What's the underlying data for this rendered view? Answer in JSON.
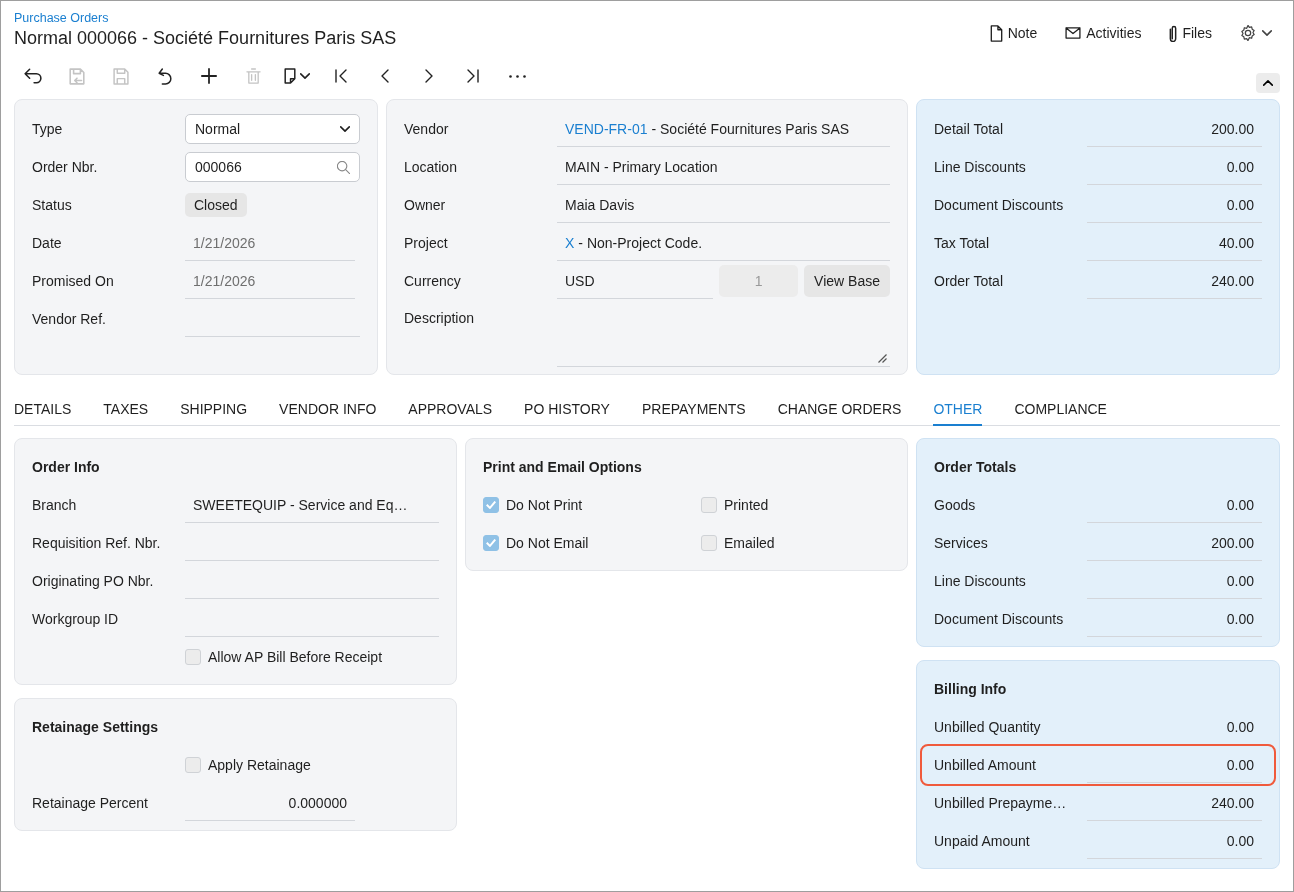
{
  "header": {
    "breadcrumb": "Purchase Orders",
    "title": "Normal 000066 - Société Fournitures Paris SAS",
    "actions": [
      {
        "label": "Note"
      },
      {
        "label": "Activities"
      },
      {
        "label": "Files"
      }
    ]
  },
  "toolbar": [
    {
      "disabled": false
    },
    {
      "disabled": true
    },
    {
      "disabled": true
    },
    {
      "disabled": false
    },
    {
      "disabled": false
    },
    {
      "disabled": true
    },
    {
      "disabled": false
    },
    {
      "disabled": false
    },
    {
      "disabled": false
    },
    {
      "disabled": false
    },
    {
      "disabled": false
    },
    {
      "disabled": false
    }
  ],
  "summary": {
    "fields": [
      {
        "label": "Type",
        "kind": "select",
        "value": "Normal"
      },
      {
        "label": "Order Nbr.",
        "kind": "search",
        "value": "000066"
      },
      {
        "label": "Status",
        "kind": "badge",
        "value": "Closed"
      },
      {
        "label": "Date",
        "kind": "readonly",
        "value": "1/21/2026"
      },
      {
        "label": "Promised On",
        "kind": "readonly",
        "value": "1/21/2026"
      },
      {
        "label": "Vendor Ref.",
        "kind": "text"
      }
    ]
  },
  "vendor": {
    "fields": [
      {
        "label": "Vendor",
        "kind": "link",
        "link": "VEND-FR-01",
        "value": "- Société Fournitures Paris SAS"
      },
      {
        "label": "Location",
        "kind": "text",
        "value": "MAIN - Primary Location"
      },
      {
        "label": "Owner",
        "kind": "text",
        "value": "Maia Davis"
      },
      {
        "label": "Project",
        "kind": "link",
        "link": "X",
        "value": "- Non-Project Code."
      },
      {
        "label": "Currency",
        "kind": "currency",
        "value": "USD",
        "rate": "1",
        "button": "View Base"
      },
      {
        "label": "Description",
        "kind": "textarea"
      }
    ]
  },
  "totals": {
    "fields": [
      {
        "label": "Detail Total",
        "value": "200.00"
      },
      {
        "label": "Line Discounts",
        "value": "0.00"
      },
      {
        "label": "Document Discounts",
        "value": "0.00"
      },
      {
        "label": "Tax Total",
        "value": "40.00"
      },
      {
        "label": "Order Total",
        "value": "240.00"
      }
    ]
  },
  "tabs": [
    {
      "label": "DETAILS",
      "selected": false
    },
    {
      "label": "TAXES",
      "selected": false
    },
    {
      "label": "SHIPPING",
      "selected": false
    },
    {
      "label": "VENDOR INFO",
      "selected": false
    },
    {
      "label": "APPROVALS",
      "selected": false
    },
    {
      "label": "PO HISTORY",
      "selected": false
    },
    {
      "label": "PREPAYMENTS",
      "selected": false
    },
    {
      "label": "CHANGE ORDERS",
      "selected": false
    },
    {
      "label": "OTHER",
      "selected": true
    },
    {
      "label": "COMPLIANCE",
      "selected": false
    }
  ],
  "order_info": {
    "title": "Order Info",
    "fields": [
      {
        "label": "Branch",
        "value": "SWEETEQUIP - Service and Eq…"
      },
      {
        "label": "Requisition Ref. Nbr."
      },
      {
        "label": "Originating PO Nbr."
      },
      {
        "label": "Workgroup ID"
      }
    ],
    "checkbox": {
      "label": "Allow AP Bill Before Receipt",
      "checked": false
    }
  },
  "retainage": {
    "title": "Retainage Settings",
    "checkbox": {
      "label": "Apply Retainage",
      "checked": false
    },
    "fields": [
      {
        "label": "Retainage Percent",
        "value": "0.000000"
      }
    ]
  },
  "print_options": {
    "title": "Print and Email Options",
    "checkboxes": [
      {
        "label": "Do Not Print",
        "checked": true
      },
      {
        "label": "Printed",
        "checked": false
      },
      {
        "label": "Do Not Email",
        "checked": true
      },
      {
        "label": "Emailed",
        "checked": false
      }
    ]
  },
  "order_totals": {
    "title": "Order Totals",
    "fields": [
      {
        "label": "Goods",
        "value": "0.00"
      },
      {
        "label": "Services",
        "value": "200.00"
      },
      {
        "label": "Line Discounts",
        "value": "0.00"
      },
      {
        "label": "Document Discounts",
        "value": "0.00"
      }
    ]
  },
  "billing": {
    "title": "Billing Info",
    "fields": [
      {
        "label": "Unbilled Quantity",
        "value": "0.00",
        "highlighted": false
      },
      {
        "label": "Unbilled Amount",
        "value": "0.00",
        "highlighted": true
      },
      {
        "label": "Unbilled Prepayme…",
        "value": "240.00",
        "highlighted": false
      },
      {
        "label": "Unpaid Amount",
        "value": "0.00",
        "highlighted": false
      }
    ]
  }
}
